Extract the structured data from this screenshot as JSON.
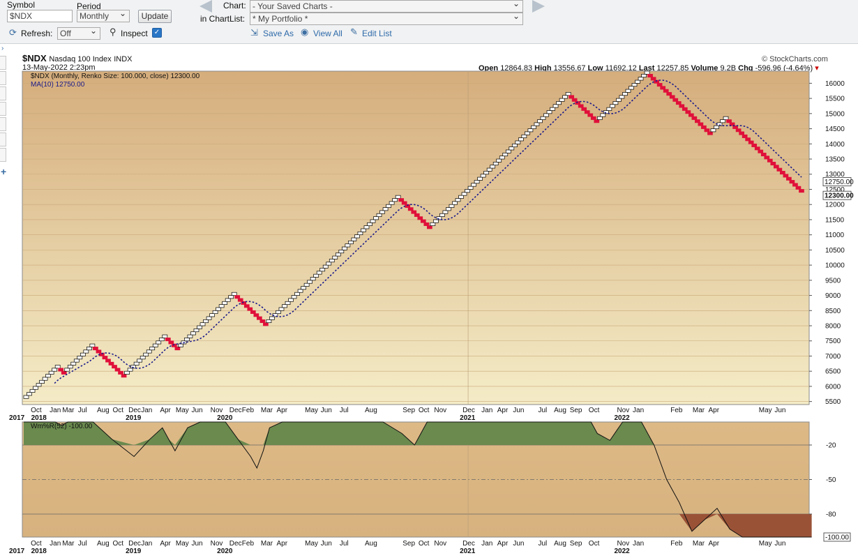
{
  "toolbar": {
    "symbol_label": "Symbol",
    "symbol_value": "$NDX",
    "period_label": "Period",
    "period_value": "Monthly",
    "update_label": "Update",
    "chart_label": "Chart:",
    "chart_value": "- Your Saved Charts -",
    "chartlist_label": "in ChartList:",
    "chartlist_value": "* My Portfolio *",
    "refresh_label": "Refresh:",
    "refresh_value": "Off",
    "inspect_label": "Inspect",
    "inspect_checked": true,
    "save_as_label": "Save As",
    "view_all_label": "View All",
    "edit_list_label": "Edit List"
  },
  "chart_header": {
    "symbol": "$NDX",
    "name": "Nasdaq 100 Index",
    "exchange": "INDX",
    "date": "13-May-2022 2:23pm",
    "brand": "© StockCharts.com",
    "open_label": "Open",
    "open": "12864.83",
    "high_label": "High",
    "high": "13556.67",
    "low_label": "Low",
    "low": "11692.12",
    "last_label": "Last",
    "last": "12257.85",
    "volume_label": "Volume",
    "volume": "9.2B",
    "chg_label": "Chg",
    "chg": "-596.96 (-4.64%)",
    "chg_color": "#cc0000"
  },
  "colors": {
    "up_box_fill": "#ffffff",
    "up_box_stroke": "#000000",
    "down_box_fill": "#e0103a",
    "ma_line": "#1a1a8a",
    "bg_top": "#d5ad7c",
    "bg_bottom": "#f4ecc7",
    "ind_green": "#6a8a4e",
    "ind_brown": "#9a5237"
  },
  "chart_data": [
    {
      "type": "renko",
      "legend": [
        {
          "text": "$NDX (Monthly, Renko Size: 100.000, close) 12300.00"
        },
        {
          "text": "MA(10) 12750.00"
        }
      ],
      "box_size": 100,
      "ylim": [
        5400,
        16400
      ],
      "y_ticks": [
        5500,
        6000,
        6500,
        7000,
        7500,
        8000,
        8500,
        9000,
        9500,
        10000,
        10500,
        11000,
        11500,
        12000,
        12500,
        13000,
        13500,
        14000,
        14500,
        15000,
        15500,
        16000
      ],
      "last_value_label": "12300.00",
      "ma_value_label": "12750.00",
      "bricks": [
        {
          "dir": "up",
          "count": 11
        },
        {
          "dir": "down",
          "count": 2
        },
        {
          "dir": "up",
          "count": 9
        },
        {
          "dir": "down",
          "count": 10
        },
        {
          "dir": "up",
          "count": 13
        },
        {
          "dir": "down",
          "count": 4
        },
        {
          "dir": "up",
          "count": 18
        },
        {
          "dir": "down",
          "count": 10
        },
        {
          "dir": "up",
          "count": 42
        },
        {
          "dir": "down",
          "count": 10
        },
        {
          "dir": "up",
          "count": 44
        },
        {
          "dir": "down",
          "count": 9
        },
        {
          "dir": "up",
          "count": 16
        },
        {
          "dir": "down",
          "count": 20
        },
        {
          "dir": "up",
          "count": 5
        },
        {
          "dir": "down",
          "count": 24
        }
      ],
      "x_month_labels": [
        {
          "label": "Oct",
          "i": 4
        },
        {
          "label": "Jan",
          "i": 10
        },
        {
          "label": "Mar",
          "i": 14
        },
        {
          "label": "Jul",
          "i": 19
        },
        {
          "label": "Aug",
          "i": 25
        },
        {
          "label": "Oct",
          "i": 30
        },
        {
          "label": "Dec",
          "i": 35
        },
        {
          "label": "Jan",
          "i": 39
        },
        {
          "label": "Apr",
          "i": 45
        },
        {
          "label": "May",
          "i": 50
        },
        {
          "label": "Jun",
          "i": 55
        },
        {
          "label": "Nov",
          "i": 61
        },
        {
          "label": "Dec",
          "i": 67
        },
        {
          "label": "Feb",
          "i": 71
        },
        {
          "label": "Mar",
          "i": 77
        },
        {
          "label": "Apr",
          "i": 82
        },
        {
          "label": "May",
          "i": 91
        },
        {
          "label": "Jun",
          "i": 96
        },
        {
          "label": "Jul",
          "i": 102
        },
        {
          "label": "Aug",
          "i": 110
        },
        {
          "label": "Sep",
          "i": 122
        },
        {
          "label": "Oct",
          "i": 127
        },
        {
          "label": "Nov",
          "i": 132
        },
        {
          "label": "Dec",
          "i": 141
        },
        {
          "label": "Jan",
          "i": 147
        },
        {
          "label": "Apr",
          "i": 152
        },
        {
          "label": "Jun",
          "i": 157
        },
        {
          "label": "Jul",
          "i": 165
        },
        {
          "label": "Aug",
          "i": 170
        },
        {
          "label": "Sep",
          "i": 175
        },
        {
          "label": "Oct",
          "i": 181
        },
        {
          "label": "Nov",
          "i": 190
        },
        {
          "label": "Jan",
          "i": 195
        },
        {
          "label": "Feb",
          "i": 207
        },
        {
          "label": "Mar",
          "i": 214
        },
        {
          "label": "Apr",
          "i": 219
        },
        {
          "label": "May",
          "i": 235
        },
        {
          "label": "Jun",
          "i": 240
        }
      ],
      "x_year_labels": [
        {
          "label": "2017",
          "i": -2
        },
        {
          "label": "2018",
          "i": 5
        },
        {
          "label": "2019",
          "i": 35
        },
        {
          "label": "2020",
          "i": 64
        },
        {
          "label": "2021",
          "i": 141
        },
        {
          "label": "2022",
          "i": 190
        }
      ]
    },
    {
      "type": "area",
      "legend": [
        {
          "text": "Wm%R(52) -100.00"
        }
      ],
      "ylim": [
        -100,
        0
      ],
      "y_ticks": [
        -20,
        -50,
        -80
      ],
      "last_value_label": "-100.00",
      "series": [
        {
          "x": [
            0,
            10,
            12,
            14,
            22,
            28,
            35,
            40,
            44,
            46,
            48,
            52,
            56,
            60,
            64,
            68,
            72,
            74,
            76,
            78,
            82,
            86,
            90,
            94,
            98,
            102,
            106,
            110,
            114,
            120,
            124,
            126,
            128,
            130,
            134,
            140,
            150,
            160,
            170,
            180,
            182,
            186,
            188,
            190,
            192,
            196,
            200,
            204,
            208,
            212,
            216,
            220,
            224,
            228,
            232,
            236,
            240,
            244,
            250
          ],
          "y": [
            0,
            0,
            -3,
            0,
            0,
            -15,
            -30,
            -15,
            -5,
            -15,
            -25,
            -5,
            0,
            0,
            0,
            -15,
            -30,
            -40,
            -25,
            -5,
            0,
            0,
            0,
            0,
            0,
            0,
            0,
            0,
            0,
            -10,
            -20,
            -10,
            0,
            0,
            0,
            0,
            0,
            0,
            0,
            0,
            -10,
            -16,
            -8,
            0,
            0,
            0,
            -20,
            -50,
            -70,
            -95,
            -85,
            -75,
            -93,
            -100,
            -100,
            -100,
            -100,
            -100,
            -100
          ]
        }
      ]
    }
  ]
}
